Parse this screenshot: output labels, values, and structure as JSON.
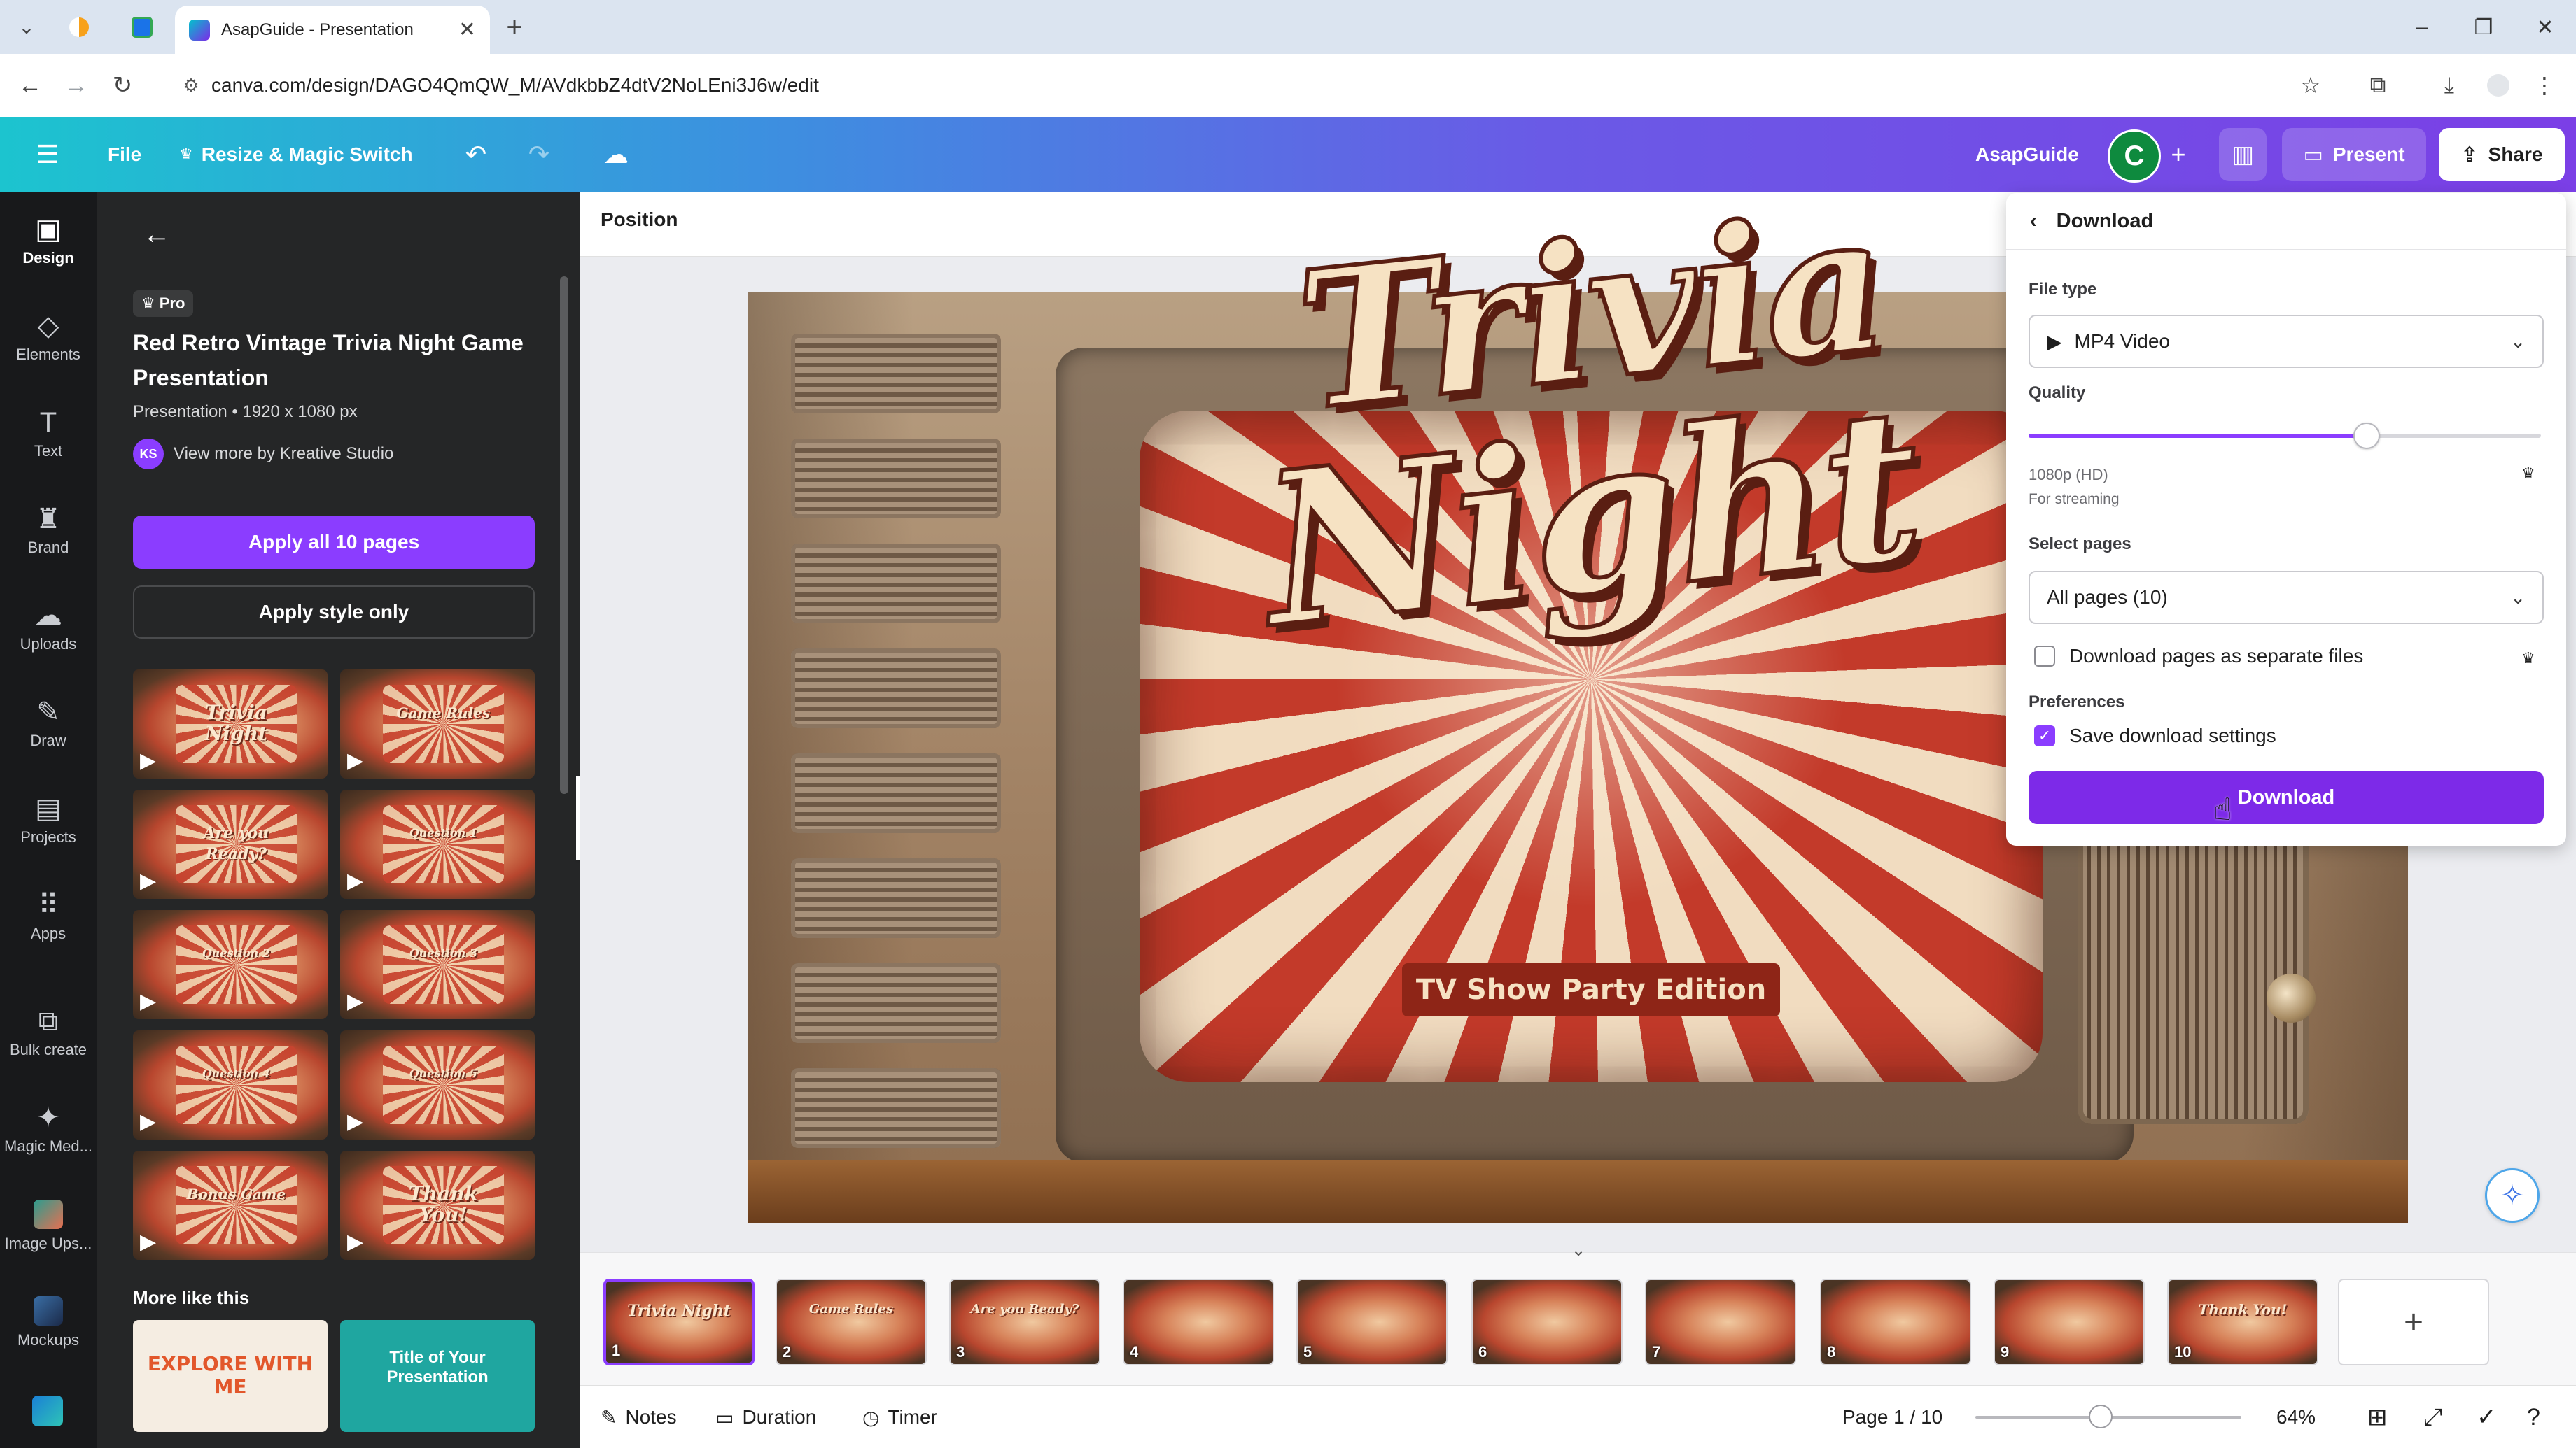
{
  "browser": {
    "tab_title": "AsapGuide - Presentation",
    "url": "canva.com/design/DAGO4QmQW_M/AVdkbbZ4dtV2NoLEni3J6w/edit",
    "icons": [
      "tab-list-icon",
      "close-icon",
      "plus-icon",
      "back-icon",
      "forward-icon",
      "reload-icon",
      "site-info-icon",
      "star-icon",
      "extensions-icon",
      "download-icon",
      "profile-icon",
      "menu-icon"
    ]
  },
  "header": {
    "file_label": "File",
    "resize_label": "Resize & Magic Switch",
    "workspace_name": "AsapGuide",
    "avatar_initial": "C",
    "present_label": "Present",
    "share_label": "Share",
    "gradient_colors": [
      "#1cc4cf",
      "#7b3fe6"
    ]
  },
  "rail": {
    "items": [
      {
        "label": "Design",
        "icon": "design-icon"
      },
      {
        "label": "Elements",
        "icon": "elements-icon"
      },
      {
        "label": "Text",
        "icon": "text-icon"
      },
      {
        "label": "Brand",
        "icon": "brand-icon"
      },
      {
        "label": "Uploads",
        "icon": "uploads-icon"
      },
      {
        "label": "Draw",
        "icon": "draw-icon"
      },
      {
        "label": "Projects",
        "icon": "projects-icon"
      },
      {
        "label": "Apps",
        "icon": "apps-icon"
      },
      {
        "label": "Bulk create",
        "icon": "bulk-create-icon"
      },
      {
        "label": "Magic Med...",
        "icon": "magic-media-icon"
      },
      {
        "label": "Image Ups...",
        "icon": "image-upscaler-icon"
      },
      {
        "label": "Mockups",
        "icon": "mockups-icon"
      }
    ]
  },
  "panel": {
    "badge": "Pro",
    "title": "Red Retro Vintage Trivia Night Game Presentation",
    "meta": "Presentation • 1920 x 1080 px",
    "author_initials": "KS",
    "author_link": "View more by Kreative Studio",
    "apply_all": "Apply all 10 pages",
    "apply_style": "Apply style only",
    "thumbs": [
      "Trivia Night",
      "Game Rules",
      "Are you Ready?",
      "Question 1",
      "Question 2",
      "Question 3",
      "Question 4",
      "Question 5",
      "Bonus Game",
      "Thank You!"
    ],
    "more_like_this": "More like this",
    "more_cards": [
      {
        "title": "EXPLORE WITH ME"
      },
      {
        "title": "Title of Your Presentation"
      }
    ]
  },
  "toolbar": {
    "position_label": "Position"
  },
  "slide": {
    "title_line1": "Trivia",
    "title_line2": "Night",
    "subtitle": "TV Show Party Edition"
  },
  "filmstrip": {
    "pages": [
      {
        "num": "1",
        "label": "Trivia Night"
      },
      {
        "num": "2",
        "label": "Game Rules"
      },
      {
        "num": "3",
        "label": "Are you Ready?"
      },
      {
        "num": "4",
        "label": ""
      },
      {
        "num": "5",
        "label": ""
      },
      {
        "num": "6",
        "label": ""
      },
      {
        "num": "7",
        "label": ""
      },
      {
        "num": "8",
        "label": ""
      },
      {
        "num": "9",
        "label": ""
      },
      {
        "num": "10",
        "label": "Thank You!"
      }
    ],
    "add_page": "+"
  },
  "footer": {
    "notes": "Notes",
    "duration": "Duration",
    "timer": "Timer",
    "page_indicator": "Page 1 / 10",
    "zoom": "64%",
    "zoom_level": 0.64
  },
  "download": {
    "header": "Download",
    "file_type_label": "File type",
    "file_type_value": "MP4 Video",
    "quality_label": "Quality",
    "quality_fraction": 0.66,
    "quality_res": "1080p (HD)",
    "quality_sub": "For streaming",
    "select_pages_label": "Select pages",
    "select_pages_value": "All pages (10)",
    "separate_files_label": "Download pages as separate files",
    "separate_files_checked": false,
    "preferences_label": "Preferences",
    "save_settings_label": "Save download settings",
    "save_settings_checked": true,
    "download_button": "Download",
    "accent": "#7d2ae8"
  }
}
